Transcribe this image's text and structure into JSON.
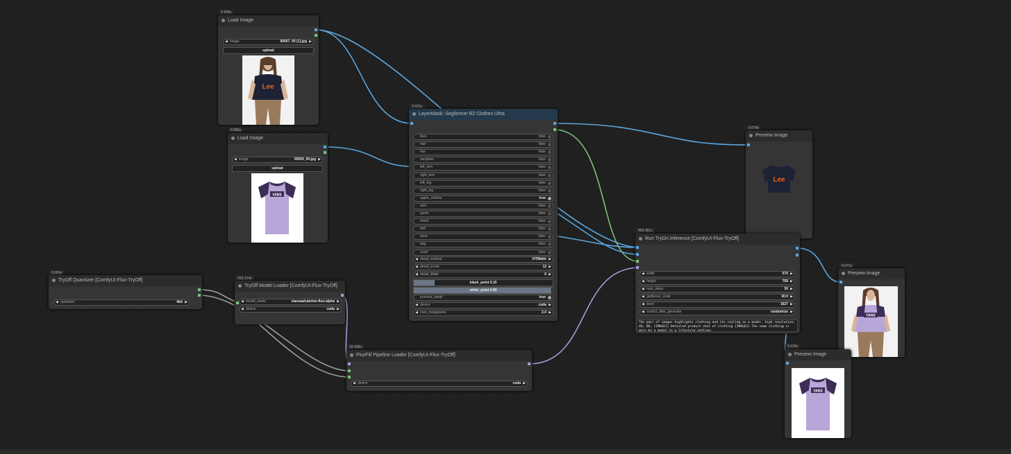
{
  "colors": {
    "image_wire": "#5ba7e0",
    "mask_wire": "#7bc37b",
    "model_wire": "#a899d6",
    "other_wire": "#9aa39a"
  },
  "nodes": {
    "load1": {
      "badge": "0.109s",
      "title": "Load Image",
      "image_label": "image",
      "image_value": "00057_00 (1).jpg",
      "upload": "upload"
    },
    "load2": {
      "badge": "0.085s",
      "title": "Load Image",
      "image_label": "image",
      "image_value": "00055_00.jpg",
      "upload": "upload"
    },
    "segformer": {
      "badge": "3.431s",
      "title": "LayerMask: Segformer B2 Clothes Ultra",
      "toggles": [
        {
          "label": "face",
          "value": "false"
        },
        {
          "label": "hair",
          "value": "false"
        },
        {
          "label": "hat",
          "value": "false"
        },
        {
          "label": "sunglass",
          "value": "false"
        },
        {
          "label": "left_arm",
          "value": "false"
        },
        {
          "label": "right_arm",
          "value": "false"
        },
        {
          "label": "left_leg",
          "value": "false"
        },
        {
          "label": "right_leg",
          "value": "false"
        },
        {
          "label": "upper_clothes",
          "value": "true"
        },
        {
          "label": "skirt",
          "value": "false"
        },
        {
          "label": "pants",
          "value": "false"
        },
        {
          "label": "dress",
          "value": "false"
        },
        {
          "label": "belt",
          "value": "false"
        },
        {
          "label": "shoe",
          "value": "false"
        },
        {
          "label": "bag",
          "value": "false"
        },
        {
          "label": "scarf",
          "value": "false"
        }
      ],
      "detail_method_label": "detail_method",
      "detail_method": "VITMatte",
      "detail_erode_label": "detail_erode",
      "detail_erode": "12",
      "detail_dilate_label": "detail_dilate",
      "detail_dilate": "6",
      "black_point": "black_point  0.15",
      "black_point_value": 0.15,
      "white_point": "white_point  0.99",
      "white_point_value": 0.99,
      "process_detail_label": "process_detail",
      "process_detail": "true",
      "device_label": "device",
      "device": "cuda",
      "max_megapixels_label": "max_megapixels",
      "max_megapixels": "2.0"
    },
    "preview1": {
      "badge": "0.078s",
      "title": "Preview Image"
    },
    "tryon": {
      "badge": "403.451s",
      "title": "Run TryOn Inference [ComfyUI-Flux-TryOff]",
      "widgets": [
        {
          "label": "width",
          "value": "576"
        },
        {
          "label": "height",
          "value": "768"
        },
        {
          "label": "num_steps",
          "value": "50"
        },
        {
          "label": "guidance_scale",
          "value": "30.0"
        },
        {
          "label": "seed",
          "value": "1627"
        },
        {
          "label": "control_after_generate",
          "value": "randomize"
        }
      ],
      "prompt": "The pair of images highlights clothing and its styling on a model, high resolution, 4K, 8K; [IMAGE1] Detailed product shot of clothing [IMAGE2] The same clothing is worn by a model in a lifestyle setting."
    },
    "preview2": {
      "badge": "0.071s",
      "title": "Preview Image"
    },
    "preview3": {
      "badge": "0.124s",
      "title": "Preview Image"
    },
    "quantizer": {
      "badge": "0.000s",
      "title": "TryOff Quantizer [ComfyUI-Flux-TryOff]",
      "label": "quantizer",
      "value": "4bit"
    },
    "modelloader": {
      "badge": "263.214s",
      "title": "TryOff Model Loader [ComfyUI-Flux-TryOff]",
      "model_label": "model_name",
      "model_value": "xiaozaa/catvton-flux-alpha",
      "device_label": "device",
      "device_value": "cuda"
    },
    "fluxfill": {
      "badge": "16.436s",
      "title": "FluxFill Pipeline Loader [ComfyUI-Flux-TryOff]",
      "device_label": "device",
      "device_value": "cuda"
    }
  }
}
